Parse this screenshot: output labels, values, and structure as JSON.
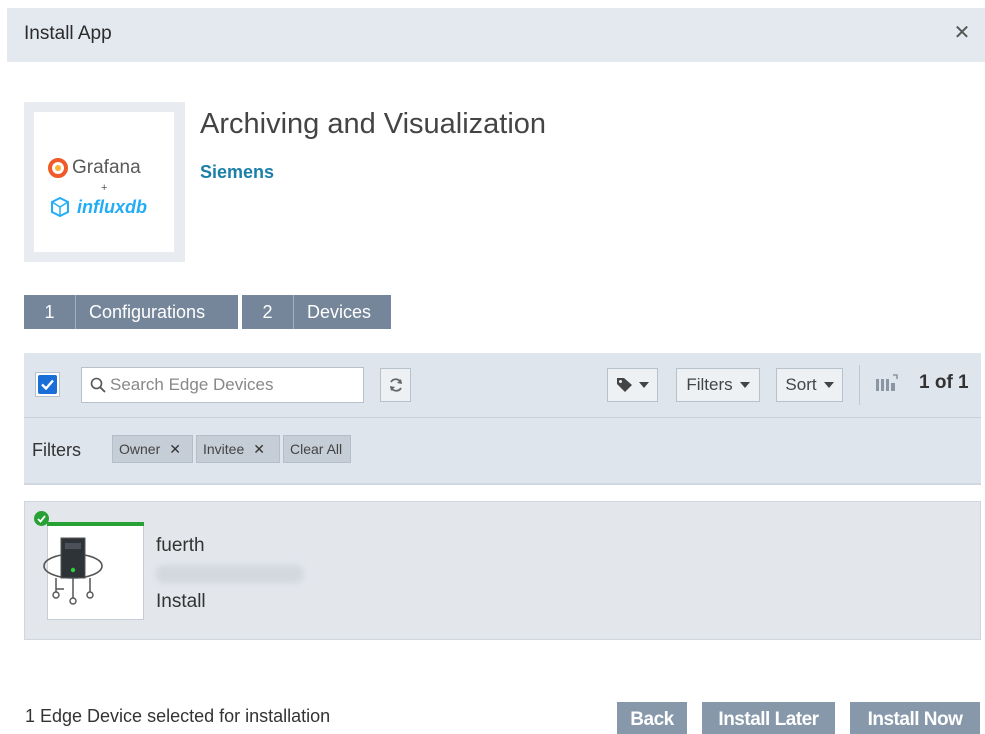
{
  "dialog": {
    "title": "Install App",
    "close_glyph": "✕"
  },
  "app": {
    "name": "Archiving and Visualization",
    "vendor": "Siemens",
    "logo": {
      "top_text": "Grafana",
      "plus": "+",
      "bottom_text": "influxdb"
    }
  },
  "steps": [
    {
      "number": "1",
      "label": "Configurations"
    },
    {
      "number": "2",
      "label": "Devices"
    }
  ],
  "toolbar": {
    "select_all_checked": true,
    "search_placeholder": "Search Edge Devices",
    "search_value": "",
    "filters_label": "Filters",
    "sort_label": "Sort",
    "page_count": "1 of 1"
  },
  "active_filters": {
    "label": "Filters",
    "chips": [
      {
        "label": "Owner",
        "remove": "✕"
      },
      {
        "label": "Invitee",
        "remove": "✕"
      }
    ],
    "clear_all": "Clear All"
  },
  "devices": [
    {
      "name": "fuerth",
      "action": "Install",
      "status": "online"
    }
  ],
  "footer": {
    "selection_text": "1 Edge Device selected for installation",
    "back_label": "Back",
    "install_later_label": "Install Later",
    "install_now_label": "Install Now"
  },
  "colors": {
    "accent": "#1a6ed8",
    "step_background": "#75869a",
    "footer_button": "#8798ab",
    "vendor_link": "#1b7fa8",
    "status_online": "#27a034"
  },
  "icons": [
    "close-icon",
    "search-icon",
    "refresh-icon",
    "tag-icon",
    "views-icon",
    "device-icon",
    "status-check-icon"
  ]
}
